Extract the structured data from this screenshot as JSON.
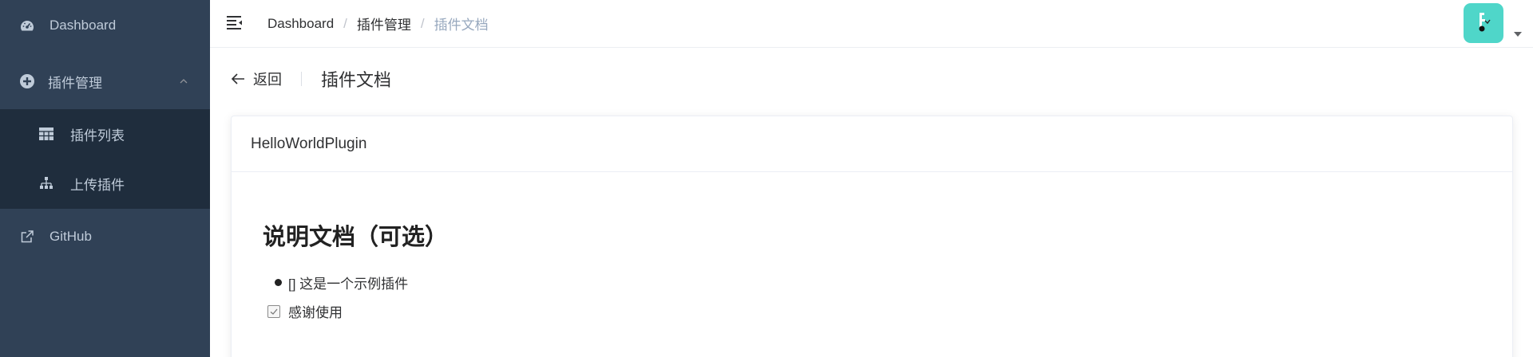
{
  "colors": {
    "sidebar_bg": "#304156",
    "submenu_bg": "#1f2d3d",
    "sidebar_text": "#bfcbd9",
    "avatar_bg": "#4fd6c9"
  },
  "sidebar": {
    "items": [
      {
        "label": "Dashboard",
        "icon": "dashboard-icon"
      },
      {
        "label": "插件管理",
        "icon": "plugin-icon",
        "expanded": true,
        "children": [
          {
            "label": "插件列表",
            "icon": "table-icon"
          },
          {
            "label": "上传插件",
            "icon": "tree-icon"
          }
        ]
      },
      {
        "label": "GitHub",
        "icon": "external-link-icon"
      }
    ]
  },
  "header": {
    "breadcrumb": [
      "Dashboard",
      "插件管理",
      "插件文档"
    ],
    "separator": "/"
  },
  "page_header": {
    "back_label": "返回",
    "title": "插件文档"
  },
  "card": {
    "title": "HelloWorldPlugin",
    "doc": {
      "heading": "说明文档（可选）",
      "bullet": "[] 这是一个示例插件",
      "task": {
        "label": "感谢使用",
        "checked": true
      }
    }
  }
}
